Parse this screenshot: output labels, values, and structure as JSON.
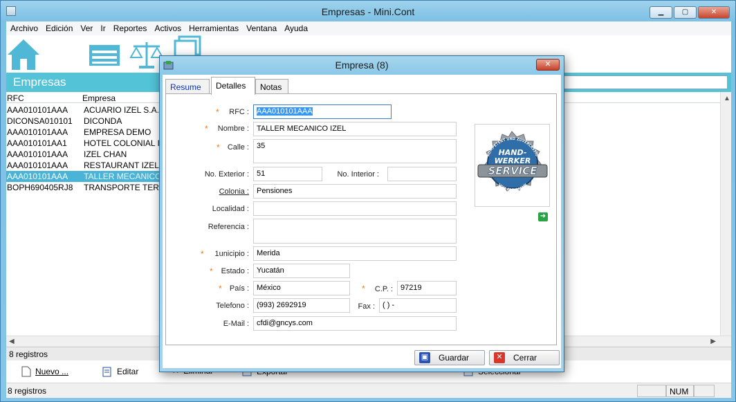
{
  "window": {
    "title": "Empresas - Mini.Cont",
    "controls": {
      "minimize": "▁",
      "maximize": "▢",
      "close": "✕"
    }
  },
  "menu": [
    "Archivo",
    "Edición",
    "Ver",
    "Ir",
    "Reportes",
    "Activos",
    "Herramientas",
    "Ventana",
    "Ayuda"
  ],
  "toolbar_icons": [
    "home-icon",
    "table-icon",
    "scale-icon",
    "documents-icon"
  ],
  "section": {
    "title": "Empresas",
    "search_value": ""
  },
  "grid": {
    "columns": [
      "RFC",
      "Empresa"
    ],
    "rows": [
      {
        "rfc": "AAA010101AAA",
        "empresa": "ACUARIO IZEL S.A. D"
      },
      {
        "rfc": "DICONSA010101",
        "empresa": "DICONDA"
      },
      {
        "rfc": "AAA010101AAA",
        "empresa": "EMPRESA DEMO"
      },
      {
        "rfc": "AAA010101AA1",
        "empresa": "HOTEL COLONIAL IZ"
      },
      {
        "rfc": "AAA010101AAA",
        "empresa": "IZEL CHAN"
      },
      {
        "rfc": "AAA010101AAA",
        "empresa": "RESTAURANT IZEL"
      },
      {
        "rfc": "AAA010101AAA",
        "empresa": "TALLER MECANICO",
        "selected": true
      },
      {
        "rfc": "BOPH690405RJ8",
        "empresa": "TRANSPORTE TERR"
      }
    ]
  },
  "record_count": "8 registros",
  "actions": {
    "nuevo": "Nuevo ...",
    "editar": "Editar",
    "eliminar": "Eliminar",
    "exportar": "Exportar",
    "seleccionar": "Seleccionar"
  },
  "status": {
    "text": "8 registros",
    "num": "NUM"
  },
  "dialog": {
    "title": "Empresa (8)",
    "close": "✕",
    "tabs": [
      "Resume",
      "Detalles",
      "Notas"
    ],
    "active_tab": "Detalles",
    "labels": {
      "rfc": "RFC :",
      "nombre": "Nombre :",
      "calle": "Calle :",
      "no_exterior": "No. Exterior :",
      "no_interior": "No. Interior :",
      "colonia": "Colonia :",
      "localidad": "Localidad :",
      "referencia": "Referencia :",
      "municipio": "1unicipio :",
      "estado": "Estado :",
      "pais": "País :",
      "cp": "C.P. :",
      "telefono": "Telefono :",
      "fax": "Fax :",
      "email": "E-Mail :"
    },
    "values": {
      "rfc": "AAA010101AAA",
      "nombre": "TALLER MECANICO IZEL",
      "calle": "35",
      "no_exterior": "51",
      "no_interior": "",
      "colonia": "Pensiones",
      "localidad": "",
      "referencia": "",
      "municipio": "Merida",
      "estado": "Yucatán",
      "pais": "México",
      "cp": "97219",
      "telefono": "(993) 2692919",
      "fax": "(  )   -",
      "email": "cfdi@gncys.com"
    },
    "logo": {
      "top_arc": "KOMPETENT UND ZUVERLÄSSIG",
      "line1": "HAND-",
      "line2": "WERKER",
      "line3": "SERVICE",
      "bottom_arc": "VOM FACHMANN"
    },
    "buttons": {
      "save": "Guardar",
      "cancel": "Cerrar"
    },
    "required_mark": "*"
  },
  "colors": {
    "accent": "#53c3d8",
    "selection": "#4ab4d8",
    "required": "#f07c1c"
  }
}
